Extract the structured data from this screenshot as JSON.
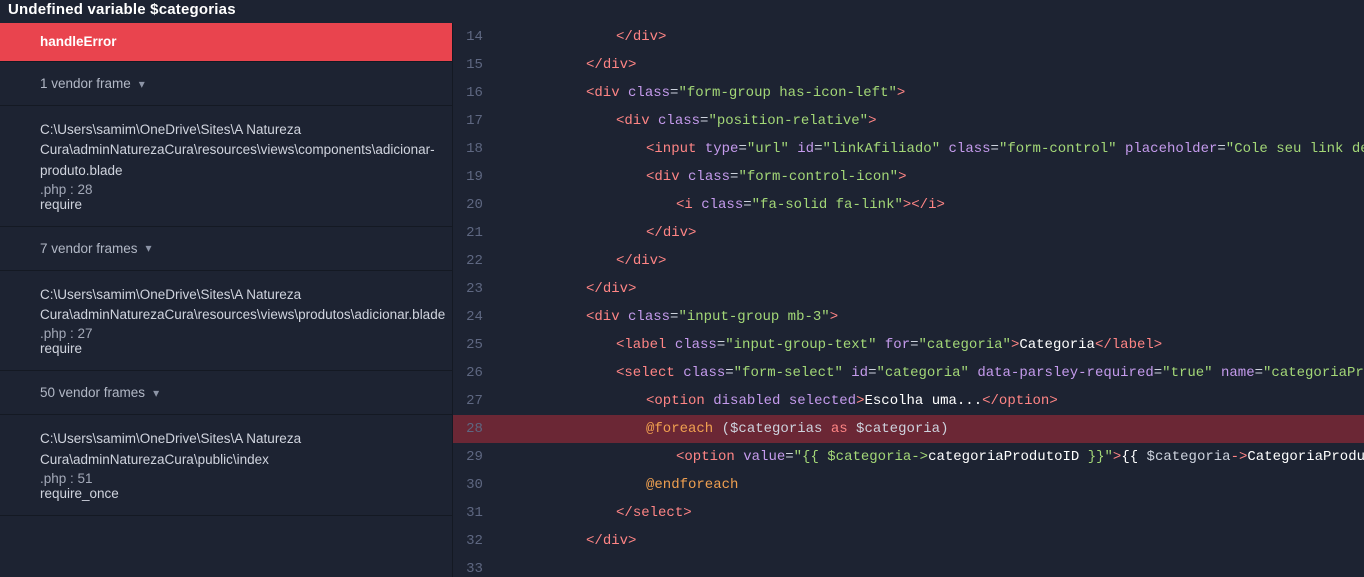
{
  "title": "Undefined variable $categorias",
  "sidebar": {
    "topFrame": "handleError",
    "vendor1": "1 vendor frame",
    "frame1": {
      "name": "C:\\Users\\samim\\OneDrive\\Sites\\A Natureza Cura\\adminNaturezaCura\\resources\\views\\components\\adicionar-produto.blade",
      "line": ".php : 28",
      "req": "require"
    },
    "vendor2": "7 vendor frames",
    "frame2": {
      "name": "C:\\Users\\samim\\OneDrive\\Sites\\A Natureza Cura\\adminNaturezaCura\\resources\\views\\produtos\\adicionar.blade",
      "line": ".php : 27",
      "req": "require"
    },
    "vendor3": "50 vendor frames",
    "frame3": {
      "name": "C:\\Users\\samim\\OneDrive\\Sites\\A Natureza Cura\\adminNaturezaCura\\public\\index",
      "line": ".php : 51",
      "req": "require_once"
    }
  },
  "code": {
    "startLine": 14,
    "highlightLine": 28,
    "lines": [
      {
        "n": 14,
        "ind": 3,
        "seg": [
          {
            "c": "tag-b",
            "t": "</"
          },
          {
            "c": "tag-name",
            "t": "div"
          },
          {
            "c": "tag-b",
            "t": ">"
          }
        ]
      },
      {
        "n": 15,
        "ind": 2,
        "seg": [
          {
            "c": "tag-b",
            "t": "</"
          },
          {
            "c": "tag-name",
            "t": "div"
          },
          {
            "c": "tag-b",
            "t": ">"
          }
        ]
      },
      {
        "n": 16,
        "ind": 2,
        "seg": [
          {
            "c": "tag-b",
            "t": "<"
          },
          {
            "c": "tag-name",
            "t": "div"
          },
          {
            "c": "",
            "t": " "
          },
          {
            "c": "attr-name",
            "t": "class"
          },
          {
            "c": "attr-eq",
            "t": "="
          },
          {
            "c": "attr-val",
            "t": "\"form-group has-icon-left\""
          },
          {
            "c": "tag-b",
            "t": ">"
          }
        ]
      },
      {
        "n": 17,
        "ind": 3,
        "seg": [
          {
            "c": "tag-b",
            "t": "<"
          },
          {
            "c": "tag-name",
            "t": "div"
          },
          {
            "c": "",
            "t": " "
          },
          {
            "c": "attr-name",
            "t": "class"
          },
          {
            "c": "attr-eq",
            "t": "="
          },
          {
            "c": "attr-val",
            "t": "\"position-relative\""
          },
          {
            "c": "tag-b",
            "t": ">"
          }
        ]
      },
      {
        "n": 18,
        "ind": 4,
        "seg": [
          {
            "c": "tag-b",
            "t": "<"
          },
          {
            "c": "tag-name",
            "t": "input"
          },
          {
            "c": "",
            "t": " "
          },
          {
            "c": "attr-name",
            "t": "type"
          },
          {
            "c": "attr-eq",
            "t": "="
          },
          {
            "c": "attr-val",
            "t": "\"url\""
          },
          {
            "c": "",
            "t": " "
          },
          {
            "c": "attr-name",
            "t": "id"
          },
          {
            "c": "attr-eq",
            "t": "="
          },
          {
            "c": "attr-val",
            "t": "\"linkAfiliado\""
          },
          {
            "c": "",
            "t": " "
          },
          {
            "c": "attr-name",
            "t": "class"
          },
          {
            "c": "attr-eq",
            "t": "="
          },
          {
            "c": "attr-val",
            "t": "\"form-control\""
          },
          {
            "c": "",
            "t": " "
          },
          {
            "c": "attr-name",
            "t": "placeholder"
          },
          {
            "c": "attr-eq",
            "t": "="
          },
          {
            "c": "attr-val",
            "t": "\"Cole seu link de afiliado"
          }
        ]
      },
      {
        "n": 19,
        "ind": 4,
        "seg": [
          {
            "c": "tag-b",
            "t": "<"
          },
          {
            "c": "tag-name",
            "t": "div"
          },
          {
            "c": "",
            "t": " "
          },
          {
            "c": "attr-name",
            "t": "class"
          },
          {
            "c": "attr-eq",
            "t": "="
          },
          {
            "c": "attr-val",
            "t": "\"form-control-icon\""
          },
          {
            "c": "tag-b",
            "t": ">"
          }
        ]
      },
      {
        "n": 20,
        "ind": 5,
        "seg": [
          {
            "c": "tag-b",
            "t": "<"
          },
          {
            "c": "tag-name",
            "t": "i"
          },
          {
            "c": "",
            "t": " "
          },
          {
            "c": "attr-name",
            "t": "class"
          },
          {
            "c": "attr-eq",
            "t": "="
          },
          {
            "c": "attr-val",
            "t": "\"fa-solid fa-link\""
          },
          {
            "c": "tag-b",
            "t": "></"
          },
          {
            "c": "tag-name",
            "t": "i"
          },
          {
            "c": "tag-b",
            "t": ">"
          }
        ]
      },
      {
        "n": 21,
        "ind": 4,
        "seg": [
          {
            "c": "tag-b",
            "t": "</"
          },
          {
            "c": "tag-name",
            "t": "div"
          },
          {
            "c": "tag-b",
            "t": ">"
          }
        ]
      },
      {
        "n": 22,
        "ind": 3,
        "seg": [
          {
            "c": "tag-b",
            "t": "</"
          },
          {
            "c": "tag-name",
            "t": "div"
          },
          {
            "c": "tag-b",
            "t": ">"
          }
        ]
      },
      {
        "n": 23,
        "ind": 2,
        "seg": [
          {
            "c": "tag-b",
            "t": "</"
          },
          {
            "c": "tag-name",
            "t": "div"
          },
          {
            "c": "tag-b",
            "t": ">"
          }
        ]
      },
      {
        "n": 24,
        "ind": 2,
        "seg": [
          {
            "c": "tag-b",
            "t": "<"
          },
          {
            "c": "tag-name",
            "t": "div"
          },
          {
            "c": "",
            "t": " "
          },
          {
            "c": "attr-name",
            "t": "class"
          },
          {
            "c": "attr-eq",
            "t": "="
          },
          {
            "c": "attr-val",
            "t": "\"input-group mb-3\""
          },
          {
            "c": "tag-b",
            "t": ">"
          }
        ]
      },
      {
        "n": 25,
        "ind": 3,
        "seg": [
          {
            "c": "tag-b",
            "t": "<"
          },
          {
            "c": "tag-name",
            "t": "label"
          },
          {
            "c": "",
            "t": " "
          },
          {
            "c": "attr-name",
            "t": "class"
          },
          {
            "c": "attr-eq",
            "t": "="
          },
          {
            "c": "attr-val",
            "t": "\"input-group-text\""
          },
          {
            "c": "",
            "t": " "
          },
          {
            "c": "attr-name",
            "t": "for"
          },
          {
            "c": "attr-eq",
            "t": "="
          },
          {
            "c": "attr-val",
            "t": "\"categoria\""
          },
          {
            "c": "tag-b",
            "t": ">"
          },
          {
            "c": "text-w",
            "t": "Categoria"
          },
          {
            "c": "tag-b",
            "t": "</"
          },
          {
            "c": "tag-name",
            "t": "label"
          },
          {
            "c": "tag-b",
            "t": ">"
          }
        ]
      },
      {
        "n": 26,
        "ind": 3,
        "seg": [
          {
            "c": "tag-b",
            "t": "<"
          },
          {
            "c": "tag-name",
            "t": "select"
          },
          {
            "c": "",
            "t": " "
          },
          {
            "c": "attr-name",
            "t": "class"
          },
          {
            "c": "attr-eq",
            "t": "="
          },
          {
            "c": "attr-val",
            "t": "\"form-select\""
          },
          {
            "c": "",
            "t": " "
          },
          {
            "c": "attr-name",
            "t": "id"
          },
          {
            "c": "attr-eq",
            "t": "="
          },
          {
            "c": "attr-val",
            "t": "\"categoria\""
          },
          {
            "c": "",
            "t": " "
          },
          {
            "c": "attr-name",
            "t": "data-parsley-required"
          },
          {
            "c": "attr-eq",
            "t": "="
          },
          {
            "c": "attr-val",
            "t": "\"true\""
          },
          {
            "c": "",
            "t": " "
          },
          {
            "c": "attr-name",
            "t": "name"
          },
          {
            "c": "attr-eq",
            "t": "="
          },
          {
            "c": "attr-val",
            "t": "\"categoriaProdutoID\""
          },
          {
            "c": "tag-b",
            "t": ">"
          }
        ]
      },
      {
        "n": 27,
        "ind": 4,
        "seg": [
          {
            "c": "tag-b",
            "t": "<"
          },
          {
            "c": "tag-name",
            "t": "option"
          },
          {
            "c": "",
            "t": " "
          },
          {
            "c": "attr-name",
            "t": "disabled"
          },
          {
            "c": "",
            "t": " "
          },
          {
            "c": "attr-name",
            "t": "selected"
          },
          {
            "c": "tag-b",
            "t": ">"
          },
          {
            "c": "text-w",
            "t": "Escolha uma..."
          },
          {
            "c": "tag-b",
            "t": "</"
          },
          {
            "c": "tag-name",
            "t": "option"
          },
          {
            "c": "tag-b",
            "t": ">"
          }
        ]
      },
      {
        "n": 28,
        "ind": 4,
        "seg": [
          {
            "c": "blade-dir",
            "t": "@foreach"
          },
          {
            "c": "blade-var",
            "t": " ($categorias "
          },
          {
            "c": "blade-kw",
            "t": "as"
          },
          {
            "c": "blade-var",
            "t": " $categoria)"
          }
        ]
      },
      {
        "n": 29,
        "ind": 5,
        "seg": [
          {
            "c": "tag-b",
            "t": "<"
          },
          {
            "c": "tag-name",
            "t": "option"
          },
          {
            "c": "",
            "t": " "
          },
          {
            "c": "attr-name",
            "t": "value"
          },
          {
            "c": "attr-eq",
            "t": "="
          },
          {
            "c": "attr-val",
            "t": "\"{{ $categoria->"
          },
          {
            "c": "blade-prop",
            "t": "categoriaProdutoID"
          },
          {
            "c": "attr-val",
            "t": " }}\""
          },
          {
            "c": "tag-b",
            "t": ">"
          },
          {
            "c": "text-w",
            "t": "{{ "
          },
          {
            "c": "blade-var",
            "t": "$categoria"
          },
          {
            "c": "blade-kw",
            "t": "->"
          },
          {
            "c": "blade-prop",
            "t": "CategoriaProduto"
          },
          {
            "c": "text-w",
            "t": " }}"
          },
          {
            "c": "tag-b",
            "t": "</"
          },
          {
            "c": "tag-name",
            "t": "opt"
          }
        ]
      },
      {
        "n": 30,
        "ind": 4,
        "seg": [
          {
            "c": "blade-dir",
            "t": "@endforeach"
          }
        ]
      },
      {
        "n": 31,
        "ind": 3,
        "seg": [
          {
            "c": "tag-b",
            "t": "</"
          },
          {
            "c": "tag-name",
            "t": "select"
          },
          {
            "c": "tag-b",
            "t": ">"
          }
        ]
      },
      {
        "n": 32,
        "ind": 2,
        "seg": [
          {
            "c": "tag-b",
            "t": "</"
          },
          {
            "c": "tag-name",
            "t": "div"
          },
          {
            "c": "tag-b",
            "t": ">"
          }
        ]
      },
      {
        "n": 33,
        "ind": 0,
        "seg": []
      }
    ]
  }
}
